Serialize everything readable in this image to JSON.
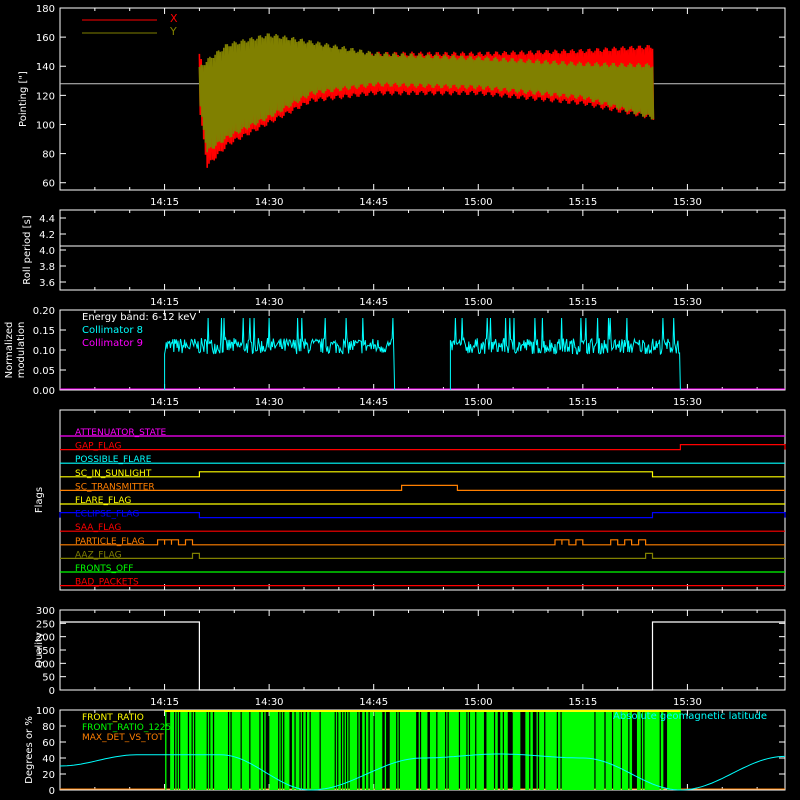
{
  "time_axis": {
    "range": [
      "14:00",
      "15:44"
    ],
    "ticks": [
      "14:15",
      "14:30",
      "14:45",
      "15:00",
      "15:15",
      "15:30"
    ]
  },
  "colors": {
    "background": "#000000",
    "frame": "#ffffff",
    "x_series": "#ff0000",
    "y_series": "#808000",
    "cyan": "#00ffff",
    "magenta": "#ff00ff",
    "green": "#00ff00",
    "orange": "#ff7f00",
    "yellow": "#ffff00",
    "blue": "#0000ff",
    "red": "#ff0000"
  },
  "chart_data": [
    {
      "type": "line",
      "id": "pointing",
      "ylabel": "Pointing [\"]",
      "ylim": [
        55,
        180
      ],
      "yticks": [
        "60",
        "80",
        "100",
        "120",
        "140",
        "160",
        "180"
      ],
      "baseline": 128,
      "series": [
        {
          "name": "X",
          "color": "#ff0000",
          "x": [
            "14:20",
            "14:21",
            "14:24",
            "14:30",
            "14:36",
            "14:45",
            "15:00",
            "15:15",
            "15:25"
          ],
          "upper": [
            150,
            130,
            135,
            142,
            148,
            150,
            150,
            152,
            155
          ],
          "lower": [
            105,
            70,
            85,
            100,
            115,
            120,
            120,
            113,
            103
          ]
        },
        {
          "name": "Y",
          "color": "#808000",
          "x": [
            "14:20",
            "14:21",
            "14:24",
            "14:30",
            "14:36",
            "14:45",
            "15:00",
            "15:15",
            "15:25"
          ],
          "upper": [
            140,
            145,
            156,
            163,
            158,
            150,
            147,
            143,
            142
          ],
          "lower": [
            110,
            80,
            90,
            104,
            120,
            126,
            124,
            117,
            103
          ]
        }
      ],
      "grid": false,
      "legend": "top-left"
    },
    {
      "type": "line",
      "id": "roll",
      "ylabel": "Roll period [s]",
      "ylim": [
        3.5,
        4.5
      ],
      "yticks": [
        "3.6",
        "3.8",
        "4.0",
        "4.2",
        "4.4"
      ],
      "series": [
        {
          "name": "",
          "color": "#ffffff",
          "x": [
            "14:00",
            "15:44"
          ],
          "y": [
            4.05,
            4.05
          ]
        }
      ]
    },
    {
      "type": "line",
      "id": "modulation",
      "ylabel": "Normalized modulation",
      "ylim": [
        0,
        0.2
      ],
      "yticks": [
        "0.00",
        "0.05",
        "0.10",
        "0.15",
        "0.20"
      ],
      "annotation": "Energy band: 6-12 keV",
      "legend": "top-left",
      "series": [
        {
          "name": "Collimator 8",
          "color": "#00ffff",
          "segments": [
            {
              "x_range": [
                "14:15",
                "14:48"
              ],
              "mean": 0.11,
              "spread": 0.02
            },
            {
              "x_range": [
                "14:56",
                "15:29"
              ],
              "mean": 0.11,
              "spread": 0.02
            }
          ]
        },
        {
          "name": "Collimator 9",
          "color": "#ff00ff",
          "x": [
            "14:00",
            "15:44"
          ],
          "y": [
            0,
            0
          ]
        }
      ]
    },
    {
      "type": "line",
      "id": "flags",
      "ylabel": "Flags",
      "flags": [
        {
          "name": "ATTENUATOR_STATE",
          "color": "#ff00ff",
          "on": []
        },
        {
          "name": "GAP_FLAG",
          "color": "#ff0000",
          "on": [
            [
              "15:29",
              "15:44"
            ]
          ]
        },
        {
          "name": "POSSIBLE_FLARE",
          "color": "#00ffff",
          "on": []
        },
        {
          "name": "SC_IN_SUNLIGHT",
          "color": "#ffff00",
          "on": [
            [
              "14:20",
              "15:25"
            ]
          ]
        },
        {
          "name": "SC_TRANSMITTER",
          "color": "#ff7f00",
          "on": [
            [
              "14:49",
              "14:57"
            ]
          ]
        },
        {
          "name": "FLARE_FLAG",
          "color": "#ffff00",
          "on": []
        },
        {
          "name": "ECLIPSE_FLAG",
          "color": "#0000ff",
          "on": [
            [
              "14:00",
              "14:20"
            ],
            [
              "15:25",
              "15:44"
            ]
          ]
        },
        {
          "name": "SAA_FLAG",
          "color": "#ff0000",
          "on": []
        },
        {
          "name": "PARTICLE_FLAG",
          "color": "#ff7f00",
          "on": [
            [
              "14:14",
              "14:15"
            ],
            [
              "14:15",
              "14:16"
            ],
            [
              "14:16",
              "14:17"
            ],
            [
              "14:18",
              "14:19"
            ],
            [
              "15:11",
              "15:12"
            ],
            [
              "15:12",
              "15:13"
            ],
            [
              "15:14",
              "15:15"
            ],
            [
              "15:19",
              "15:20"
            ],
            [
              "15:21",
              "15:22"
            ],
            [
              "15:23",
              "15:24"
            ]
          ]
        },
        {
          "name": "AAZ_FLAG",
          "color": "#808000",
          "on": [
            [
              "14:19",
              "14:20"
            ],
            [
              "15:24",
              "15:25"
            ]
          ]
        },
        {
          "name": "FRONTS_OFF",
          "color": "#00ff00",
          "on": []
        },
        {
          "name": "BAD_PACKETS",
          "color": "#ff0000",
          "on": []
        }
      ]
    },
    {
      "type": "line",
      "id": "quality",
      "ylabel": "Quality",
      "ylim": [
        0,
        300
      ],
      "yticks": [
        "0",
        "50",
        "100",
        "150",
        "200",
        "250",
        "300"
      ],
      "series": [
        {
          "name": "",
          "color": "#ffffff",
          "x": [
            "14:00",
            "14:20",
            "14:20",
            "15:25",
            "15:25",
            "15:44"
          ],
          "y": [
            255,
            255,
            0,
            0,
            255,
            255
          ]
        }
      ]
    },
    {
      "type": "line",
      "id": "ratios",
      "ylabel": "Degrees or %",
      "ylim": [
        0,
        100
      ],
      "yticks": [
        "0",
        "20",
        "40",
        "60",
        "80",
        "100"
      ],
      "legend": "top-left",
      "series": [
        {
          "name": "FRONT_RATIO",
          "color": "#ffff00",
          "x_range": [
            "14:15",
            "15:29"
          ],
          "level": 100
        },
        {
          "name": "FRONT_RATIO_1225",
          "color": "#00ff00",
          "x_range": [
            "14:15",
            "15:29"
          ],
          "level": 100
        },
        {
          "name": "MAX_DET_VS_TOT",
          "color": "#ff7f00",
          "x": [
            "14:00",
            "15:44"
          ],
          "y": [
            0,
            0
          ]
        },
        {
          "name": "Absolute geomagnetic latitude",
          "color": "#00ffff",
          "x": [
            "14:00",
            "14:11",
            "14:23",
            "14:36",
            "14:52",
            "15:03",
            "15:15",
            "15:29",
            "15:44"
          ],
          "y": [
            30,
            44,
            44,
            0,
            40,
            45,
            40,
            0,
            42
          ]
        }
      ]
    }
  ]
}
